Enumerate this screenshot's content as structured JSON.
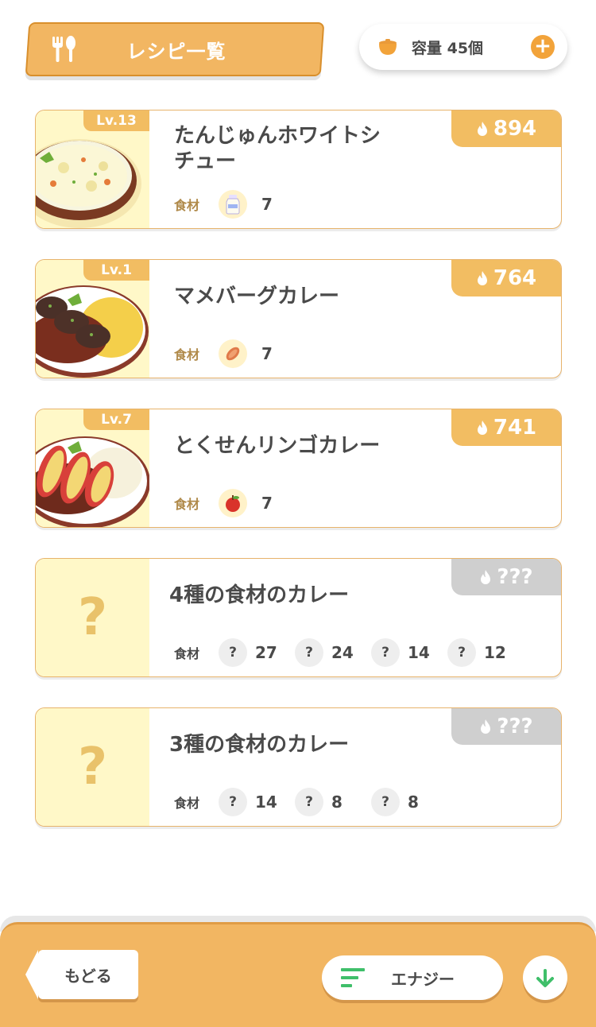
{
  "header": {
    "title": "レシピ一覧",
    "capacity_label": "容量 45個",
    "add_label": "+"
  },
  "recipes": [
    {
      "name_line1": "たんじゅんホワイトシ",
      "name_line2": "チュー",
      "level": "Lv.13",
      "energy": "894",
      "ingredients_label": "食材",
      "ingredients": [
        {
          "icon": "milk-icon",
          "count": "7"
        }
      ]
    },
    {
      "name": "マメバーグカレー",
      "level": "Lv.1",
      "energy": "764",
      "ingredients_label": "食材",
      "ingredients": [
        {
          "icon": "sausage-icon",
          "count": "7"
        }
      ]
    },
    {
      "name": "とくせんリンゴカレー",
      "level": "Lv.7",
      "energy": "741",
      "ingredients_label": "食材",
      "ingredients": [
        {
          "icon": "apple-icon",
          "count": "7"
        }
      ]
    },
    {
      "name": "4種の食材のカレー",
      "placeholder": "?",
      "energy": "???",
      "ingredients_label": "食材",
      "ingredients": [
        {
          "icon": "?",
          "count": "27"
        },
        {
          "icon": "?",
          "count": "24"
        },
        {
          "icon": "?",
          "count": "14"
        },
        {
          "icon": "?",
          "count": "12"
        }
      ]
    },
    {
      "name": "3種の食材のカレー",
      "placeholder": "?",
      "energy": "???",
      "ingredients_label": "食材",
      "ingredients": [
        {
          "icon": "?",
          "count": "14"
        },
        {
          "icon": "?",
          "count": "8"
        },
        {
          "icon": "?",
          "count": "8"
        }
      ]
    }
  ],
  "footer": {
    "back_label": "もどる",
    "sort_label": "エナジー"
  },
  "colors": {
    "accent": "#f2b662",
    "accent_dark": "#d98f2c",
    "locked": "#cfcfcf",
    "thumb_bg": "#fff8c8",
    "sort_icon": "#3fbf6a"
  }
}
